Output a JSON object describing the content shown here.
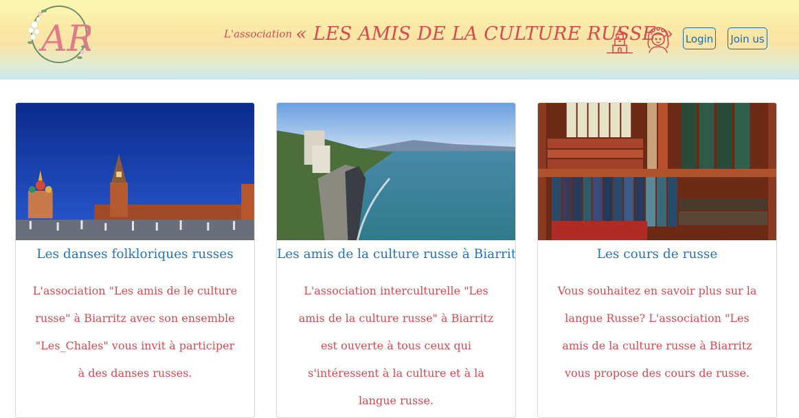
{
  "header": {
    "logo_letters": "AR",
    "title_prefix": "L'association",
    "title_main": "« LES AMIS DE LA CULTURE RUSSE »",
    "icons": [
      "kremlin-tower-icon",
      "girl-in-headscarf-icon"
    ],
    "login_label": "Login",
    "join_label": "Join us",
    "colors": {
      "title": "#d64a52",
      "button": "#1f6aa8"
    }
  },
  "cards": [
    {
      "image": "red-square-night-photo",
      "title": "Les danses folkloriques russes",
      "text": "L'association \"Les amis de le culture russe\" à Biarritz avec son ensemble \"Les_Chales\" vous invit à participer à des danses russes."
    },
    {
      "image": "biarritz-coast-photo",
      "title": "Les amis de la culture russe à Biarritz",
      "text": "L'association interculturelle \"Les amis de la culture russe\" à Biarritz est ouverte à tous ceux qui s'intéressent à la culture et à la langue russe."
    },
    {
      "image": "bookshelf-photo",
      "title": "Les cours de russe",
      "text": "Vous souhaitez en savoir plus sur la langue Russe? L'association \"Les amis de la culture russe à Biarritz vous propose des cours de russe."
    }
  ],
  "colors": {
    "card_title": "#2175c1",
    "card_text": "#d64a52"
  }
}
